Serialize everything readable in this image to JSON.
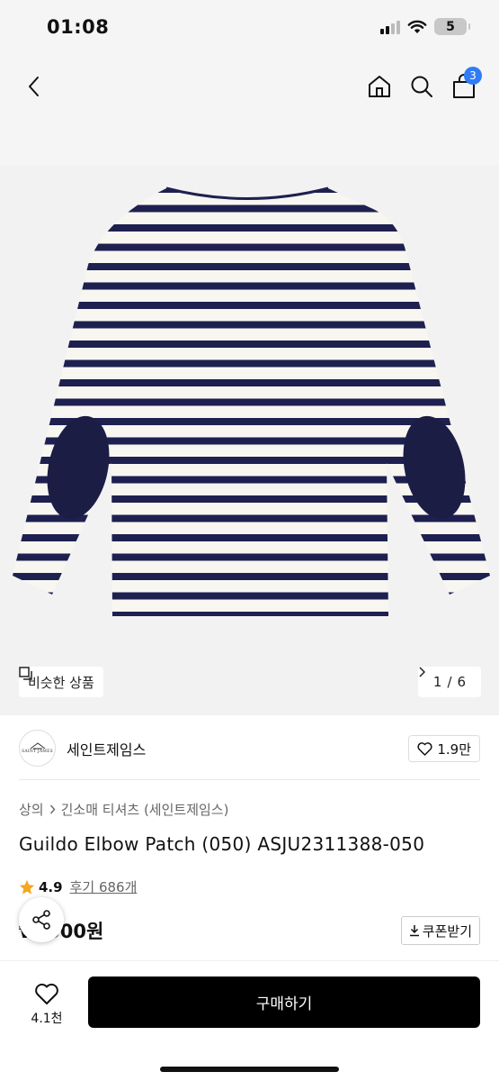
{
  "status_bar": {
    "time": "01:08",
    "battery": "5"
  },
  "nav": {
    "cart_count": "3"
  },
  "gallery": {
    "similar_label": "비슷한 상품",
    "page_current": "1",
    "page_sep": "/",
    "page_total": "6"
  },
  "brand": {
    "name": "세인트제임스",
    "logo_text": "SAINT JAMES",
    "likes": "1.9만"
  },
  "breadcrumb": {
    "items": [
      "상의",
      "긴소매 티셔츠 (세인트제임스)"
    ]
  },
  "product": {
    "title": "Guildo Elbow Patch (050) ASJU2311388-050",
    "rating": "4.9",
    "reviews": "후기 686개",
    "price": "₩,000원",
    "coupon_label": "쿠폰받기"
  },
  "bottom_bar": {
    "wish_count": "4.1천",
    "buy_label": "구매하기"
  },
  "colors": {
    "accent_blue": "#2f7cf6",
    "navy_stripe": "#1e2050",
    "star": "#f5a623"
  }
}
